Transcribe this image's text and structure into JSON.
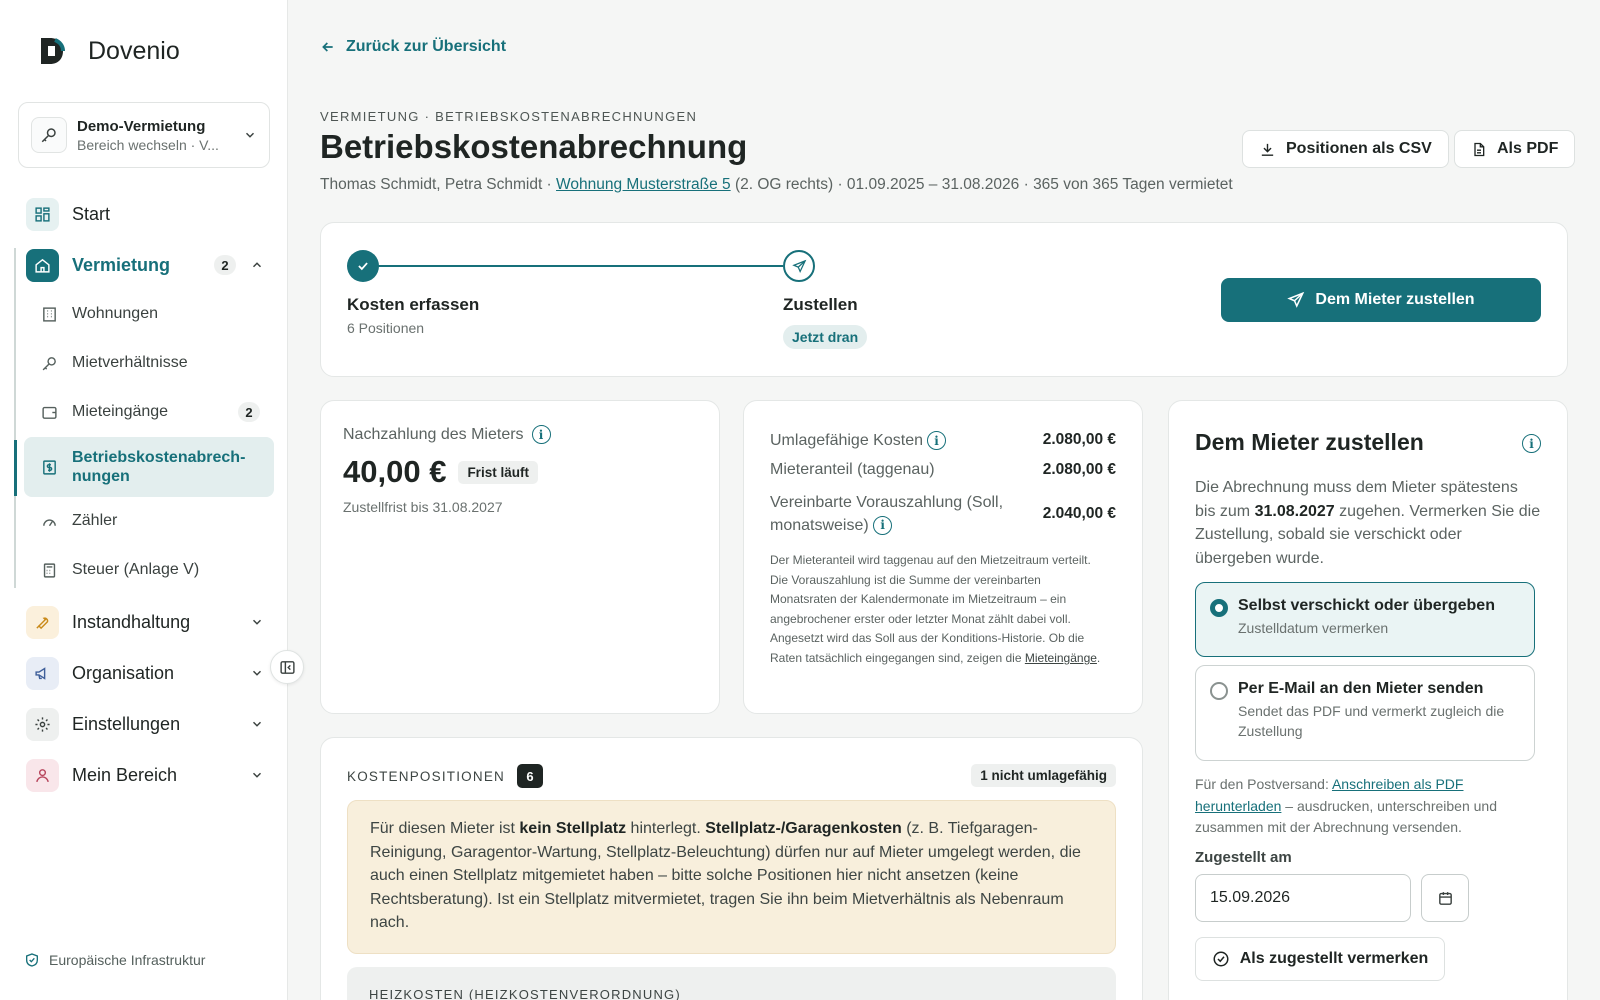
{
  "brand": {
    "name": "Dovenio"
  },
  "switcher": {
    "title": "Demo-Vermietung",
    "subtitle": "Bereich wechseln · V..."
  },
  "nav": {
    "start": "Start",
    "vermietung": {
      "label": "Vermietung",
      "badge": "2"
    },
    "sub": [
      {
        "label": "Wohnungen"
      },
      {
        "label": "Mietverhältnisse"
      },
      {
        "label": "Mieteingänge",
        "badge": "2"
      },
      {
        "label": "Betriebskostenabrech-\nnungen"
      },
      {
        "label": "Zähler"
      },
      {
        "label": "Steuer (Anlage V)"
      }
    ],
    "instandhaltung": "Instandhaltung",
    "organisation": "Organisation",
    "einstellungen": "Einstellungen",
    "mein_bereich": "Mein Bereich"
  },
  "footer": {
    "note": "Europäische Infrastruktur"
  },
  "header": {
    "back": "Zurück zur Übersicht",
    "breadcrumb": "VERMIETUNG · BETRIEBSKOSTENABRECHNUNGEN",
    "title": "Betriebskostenabrechnung",
    "sub_tenants": "Thomas Schmidt, Petra Schmidt · ",
    "sub_link": "Wohnung Musterstraße 5",
    "sub_rest": " (2. OG rechts) · 01.09.2025 – 31.08.2026 · 365 von 365 Tagen vermietet",
    "csv_button": "Positionen als CSV",
    "pdf_button": "Als PDF"
  },
  "stepper": {
    "step1": {
      "title": "Kosten erfassen",
      "sub": "6 Positionen"
    },
    "step2": {
      "title": "Zustellen",
      "pill": "Jetzt dran"
    },
    "action": "Dem Mieter zustellen"
  },
  "summary": {
    "label": "Nachzahlung des Mieters",
    "amount": "40,00 €",
    "badge": "Frist läuft",
    "deadline": "Zustellfrist bis 31.08.2027"
  },
  "figures": {
    "rows": [
      {
        "label": "Umlagefähige Kosten",
        "value": "2.080,00 €"
      },
      {
        "label": "Mieteranteil (taggenau)",
        "value": "2.080,00 €"
      },
      {
        "label": "Vereinbarte Vorauszahlung (Soll, monatsweise)",
        "value": "2.040,00 €"
      }
    ],
    "note": "Der Mieteranteil wird taggenau auf den Mietzeitraum verteilt. Die Vorauszahlung ist die Summe der vereinbarten Monatsraten der Kalendermonate im Mietzeitraum – ein angebrochener erster oder letzter Monat zählt dabei voll. Angesetzt wird das Soll aus der Konditions-Historie. Ob die Raten tatsächlich eingegangen sind, zeigen die ",
    "note_link": "Mieteingänge",
    "note_end": "."
  },
  "positions": {
    "heading": "KOSTENPOSITIONEN",
    "count": "6",
    "badge": "1 nicht umlagefähig",
    "warn_1": "Für diesen Mieter ist ",
    "warn_b1": "kein Stellplatz",
    "warn_2": " hinterlegt. ",
    "warn_b2": "Stellplatz-/Garagenkosten",
    "warn_3": " (z. B. Tiefgaragen-Reinigung, Garagentor-Wartung, Stellplatz-Beleuchtung) dürfen nur auf Mieter umgelegt werden, die auch einen Stellplatz mitgemietet haben – bitte solche Positionen hier nicht ansetzen (keine Rechtsberatung). Ist ein Stellplatz mitvermietet, tragen Sie ihn beim Mietverhältnis als Nebenraum nach.",
    "group": "HEIZKOSTEN (HEIZKOSTENVERORDNUNG)"
  },
  "deliver": {
    "title": "Dem Mieter zustellen",
    "text_1": "Die Abrechnung muss dem Mieter spätestens bis zum ",
    "text_b": "31.08.2027",
    "text_2": " zugehen. Vermerken Sie die Zustellung, sobald sie verschickt oder übergeben wurde.",
    "opt1": {
      "title": "Selbst verschickt oder übergeben",
      "sub": "Zustelldatum vermerken"
    },
    "opt2": {
      "title": "Per E-Mail an den Mieter senden",
      "sub": "Sendet das PDF und vermerkt zugleich die Zustellung"
    },
    "post_1": "Für den Postversand: ",
    "post_link": "Anschreiben als PDF herunterladen",
    "post_2": " – ausdrucken, unterschreiben und zusammen mit der Abrechnung versenden.",
    "date_label": "Zugestellt am",
    "date_value": "15.09.2026",
    "confirm": "Als zugestellt vermerken"
  },
  "colors": {
    "accent": "#17707a",
    "warn_bg": "#f8efdc"
  }
}
